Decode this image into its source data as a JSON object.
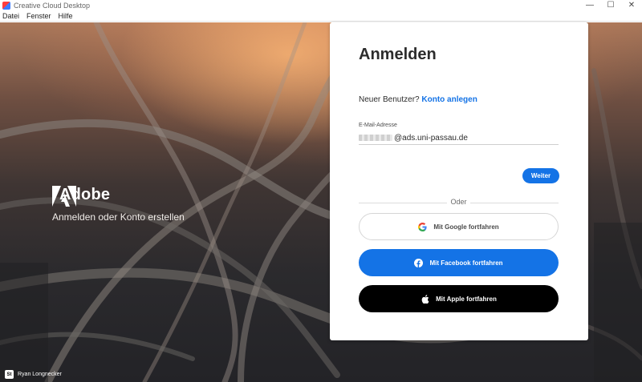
{
  "window": {
    "title": "Creative Cloud Desktop",
    "controls": {
      "minimize": "—",
      "maximize": "☐",
      "close": "✕"
    }
  },
  "menu": {
    "items": [
      "Datei",
      "Fenster",
      "Hilfe"
    ]
  },
  "hero": {
    "brand_name": "Adobe",
    "tagline": "Anmelden oder Konto erstellen",
    "photo_credit": "Ryan Longnecker",
    "credit_badge": "St"
  },
  "login": {
    "title": "Anmelden",
    "new_user_prompt": "Neuer Benutzer?",
    "create_account_link": "Konto anlegen",
    "email_label": "E-Mail-Adresse",
    "email_value_visible": "@ads.uni-passau.de",
    "continue_button": "Weiter",
    "divider_text": "Oder",
    "google_button": "Mit Google fortfahren",
    "facebook_button": "Mit Facebook fortfahren",
    "apple_button": "Mit Apple fortfahren"
  },
  "colors": {
    "accent": "#1473e6",
    "apple_button": "#000000"
  },
  "icons": {
    "app": "creative-cloud-icon",
    "brand": "adobe-logo-icon",
    "google": "google-icon",
    "facebook": "facebook-icon",
    "apple": "apple-icon"
  }
}
